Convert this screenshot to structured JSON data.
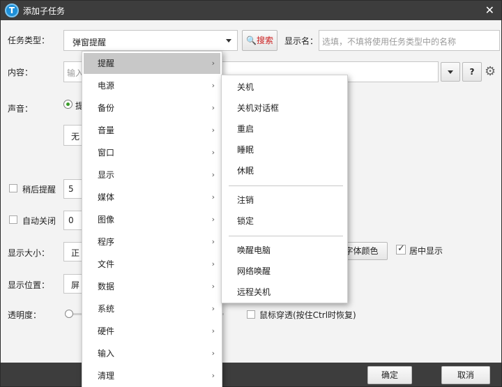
{
  "window": {
    "title": "添加子任务",
    "app_icon_letter": "T"
  },
  "form": {
    "task_type_label": "任务类型：",
    "task_type_value": "弹窗提醒",
    "search_label": "搜索",
    "display_name_label": "显示名：",
    "display_name_placeholder": "选填，不填将使用任务类型中的名称",
    "content_label": "内容：",
    "content_placeholder": "输入",
    "help_label": "?",
    "sound_label": "声音：",
    "sound_radio_partial": "提",
    "sound_select_partial": "无",
    "snooze_label": "稍后提醒",
    "snooze_value": "5",
    "autoclose_label": "自动关闭",
    "autoclose_value": "0",
    "size_label": "显示大小：",
    "size_value_partial": "正",
    "font_color_label": "字体颜色",
    "center_label": "居中显示",
    "position_label": "显示位置：",
    "position_value_partial": "屏",
    "opacity_label": "透明度：",
    "mouse_through_label": "鼠标穿透(按住Ctrl时恢复)"
  },
  "menu": {
    "items": [
      "提醒",
      "电源",
      "备份",
      "音量",
      "窗口",
      "显示",
      "媒体",
      "图像",
      "程序",
      "文件",
      "数据",
      "系统",
      "硬件",
      "输入",
      "清理"
    ],
    "active_index": 0,
    "arrow_glyph": "›"
  },
  "submenu": {
    "groups": [
      [
        "关机",
        "关机对话框",
        "重启",
        "睡眠",
        "休眠"
      ],
      [
        "注销",
        "锁定"
      ],
      [
        "唤醒电脑",
        "网络唤醒",
        "远程关机"
      ]
    ]
  },
  "footer": {
    "ok_label": "确定",
    "cancel_label": "取消"
  },
  "colors": {
    "titlebar": "#3d3d3d",
    "menu_highlight": "#c8c8c8",
    "search_text": "#cc2222",
    "app_icon": "#1d8fd8"
  }
}
